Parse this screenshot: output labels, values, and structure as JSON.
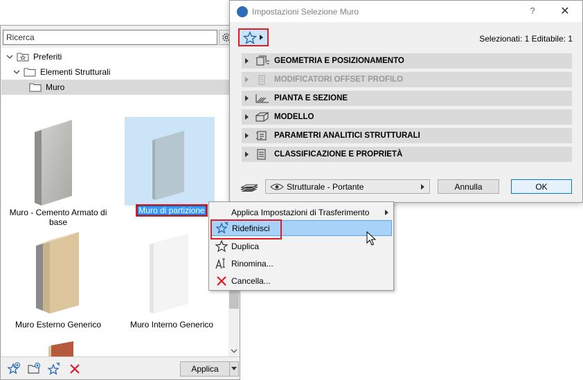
{
  "palette": {
    "search_placeholder": "Ricerca",
    "tree": [
      {
        "label": "Preferiti",
        "icon": "favorites-folder-icon"
      },
      {
        "label": "Elementi Strutturali",
        "icon": "folder-icon"
      },
      {
        "label": "Muro",
        "icon": "folder-icon"
      }
    ],
    "thumbnails": [
      {
        "label": "Muro - Cemento Armato di base"
      },
      {
        "label": "Muro di partizione"
      },
      {
        "label": "Muro Esterno Generico"
      },
      {
        "label": "Muro Interno Generico"
      }
    ],
    "apply_label": "Applica"
  },
  "dialog": {
    "title": "Impostazioni Selezione Muro",
    "help": "?",
    "close": "✕",
    "selection_status": "Selezionati: 1 Editabile: 1",
    "panels": [
      {
        "label": "GEOMETRIA E POSIZIONAMENTO",
        "enabled": true
      },
      {
        "label": "MODIFICATORI OFFSET PROFILO",
        "enabled": false
      },
      {
        "label": "PIANTA E SEZIONE",
        "enabled": true
      },
      {
        "label": "MODELLO",
        "enabled": true
      },
      {
        "label": "PARAMETRI ANALITICI STRUTTURALI",
        "enabled": true
      },
      {
        "label": "CLASSIFICAZIONE E PROPRIETÀ",
        "enabled": true
      }
    ],
    "view_option": "Strutturale - Portante",
    "cancel_label": "Annulla",
    "ok_label": "OK"
  },
  "context_menu": {
    "items": [
      {
        "label": "Applica Impostazioni di Trasferimento",
        "has_submenu": true
      },
      {
        "label": "Ridefinisci",
        "highlighted": true
      },
      {
        "label": "Duplica"
      },
      {
        "label": "Rinomina..."
      },
      {
        "label": "Cancella..."
      }
    ]
  },
  "colors": {
    "highlight_red": "#e01b24",
    "selection_blue": "#3399ff",
    "star_blue": "#1a5fb4"
  }
}
